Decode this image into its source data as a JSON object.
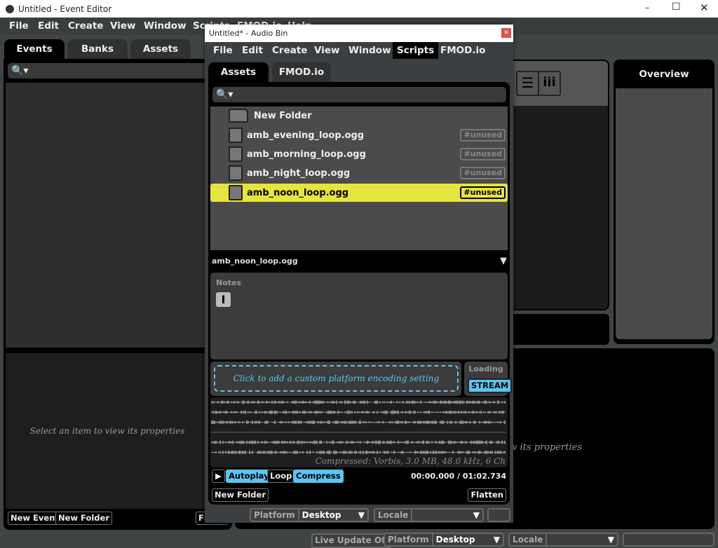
{
  "main_window": {
    "title": "Untitled - Event Editor",
    "menu": [
      "File",
      "Edit",
      "Create",
      "View",
      "Window",
      "Scripts",
      "FMOD.io",
      "Help"
    ],
    "tabs": [
      "Events",
      "Banks",
      "Assets"
    ],
    "properties_placeholder": "Select an item to view its properties",
    "buttons": {
      "new_event": "New Event",
      "new_folder": "New Folder",
      "flatten": "Flatten"
    },
    "overview_title": "Overview",
    "status": {
      "live_update": "Live Update Off",
      "platform_label": "Platform",
      "platform_value": "Desktop",
      "locale_label": "Locale",
      "locale_value": ""
    }
  },
  "audio_bin": {
    "title": "Untitled* - Audio Bin",
    "menu": [
      "File",
      "Edit",
      "Create",
      "View",
      "Window",
      "Scripts",
      "FMOD.io"
    ],
    "active_menu": "Scripts",
    "tabs": [
      "Assets",
      "FMOD.io"
    ],
    "items": [
      {
        "name": "New Folder",
        "type": "folder",
        "tag": ""
      },
      {
        "name": "amb_evening_loop.ogg",
        "type": "audio",
        "tag": "#unused"
      },
      {
        "name": "amb_morning_loop.ogg",
        "type": "audio",
        "tag": "#unused"
      },
      {
        "name": "amb_night_loop.ogg",
        "type": "audio",
        "tag": "#unused"
      },
      {
        "name": "amb_noon_loop.ogg",
        "type": "audio",
        "tag": "#unused",
        "selected": true
      }
    ],
    "selected_file": "amb_noon_loop.ogg",
    "notes_label": "Notes",
    "encoding_prompt": "Click to add a custom platform encoding setting",
    "loading_label": "Loading",
    "loading_mode": "STREAM",
    "waveform_info": "Compressed: Vorbis, 3.0 MB, 48.0 kHz, 6 Ch",
    "channels": 6,
    "transport": {
      "autoplay": "Autoplay",
      "loop": "Loop",
      "compress": "Compress",
      "time": "00:00.000 / 01:02.734"
    },
    "buttons": {
      "new_folder": "New Folder",
      "flatten": "Flatten"
    },
    "status": {
      "platform_label": "Platform",
      "platform_value": "Desktop",
      "locale_label": "Locale",
      "locale_value": ""
    }
  },
  "colors": {
    "accent": "#5bc5f2",
    "selection": "#e6e43e",
    "close": "#d9534f"
  }
}
